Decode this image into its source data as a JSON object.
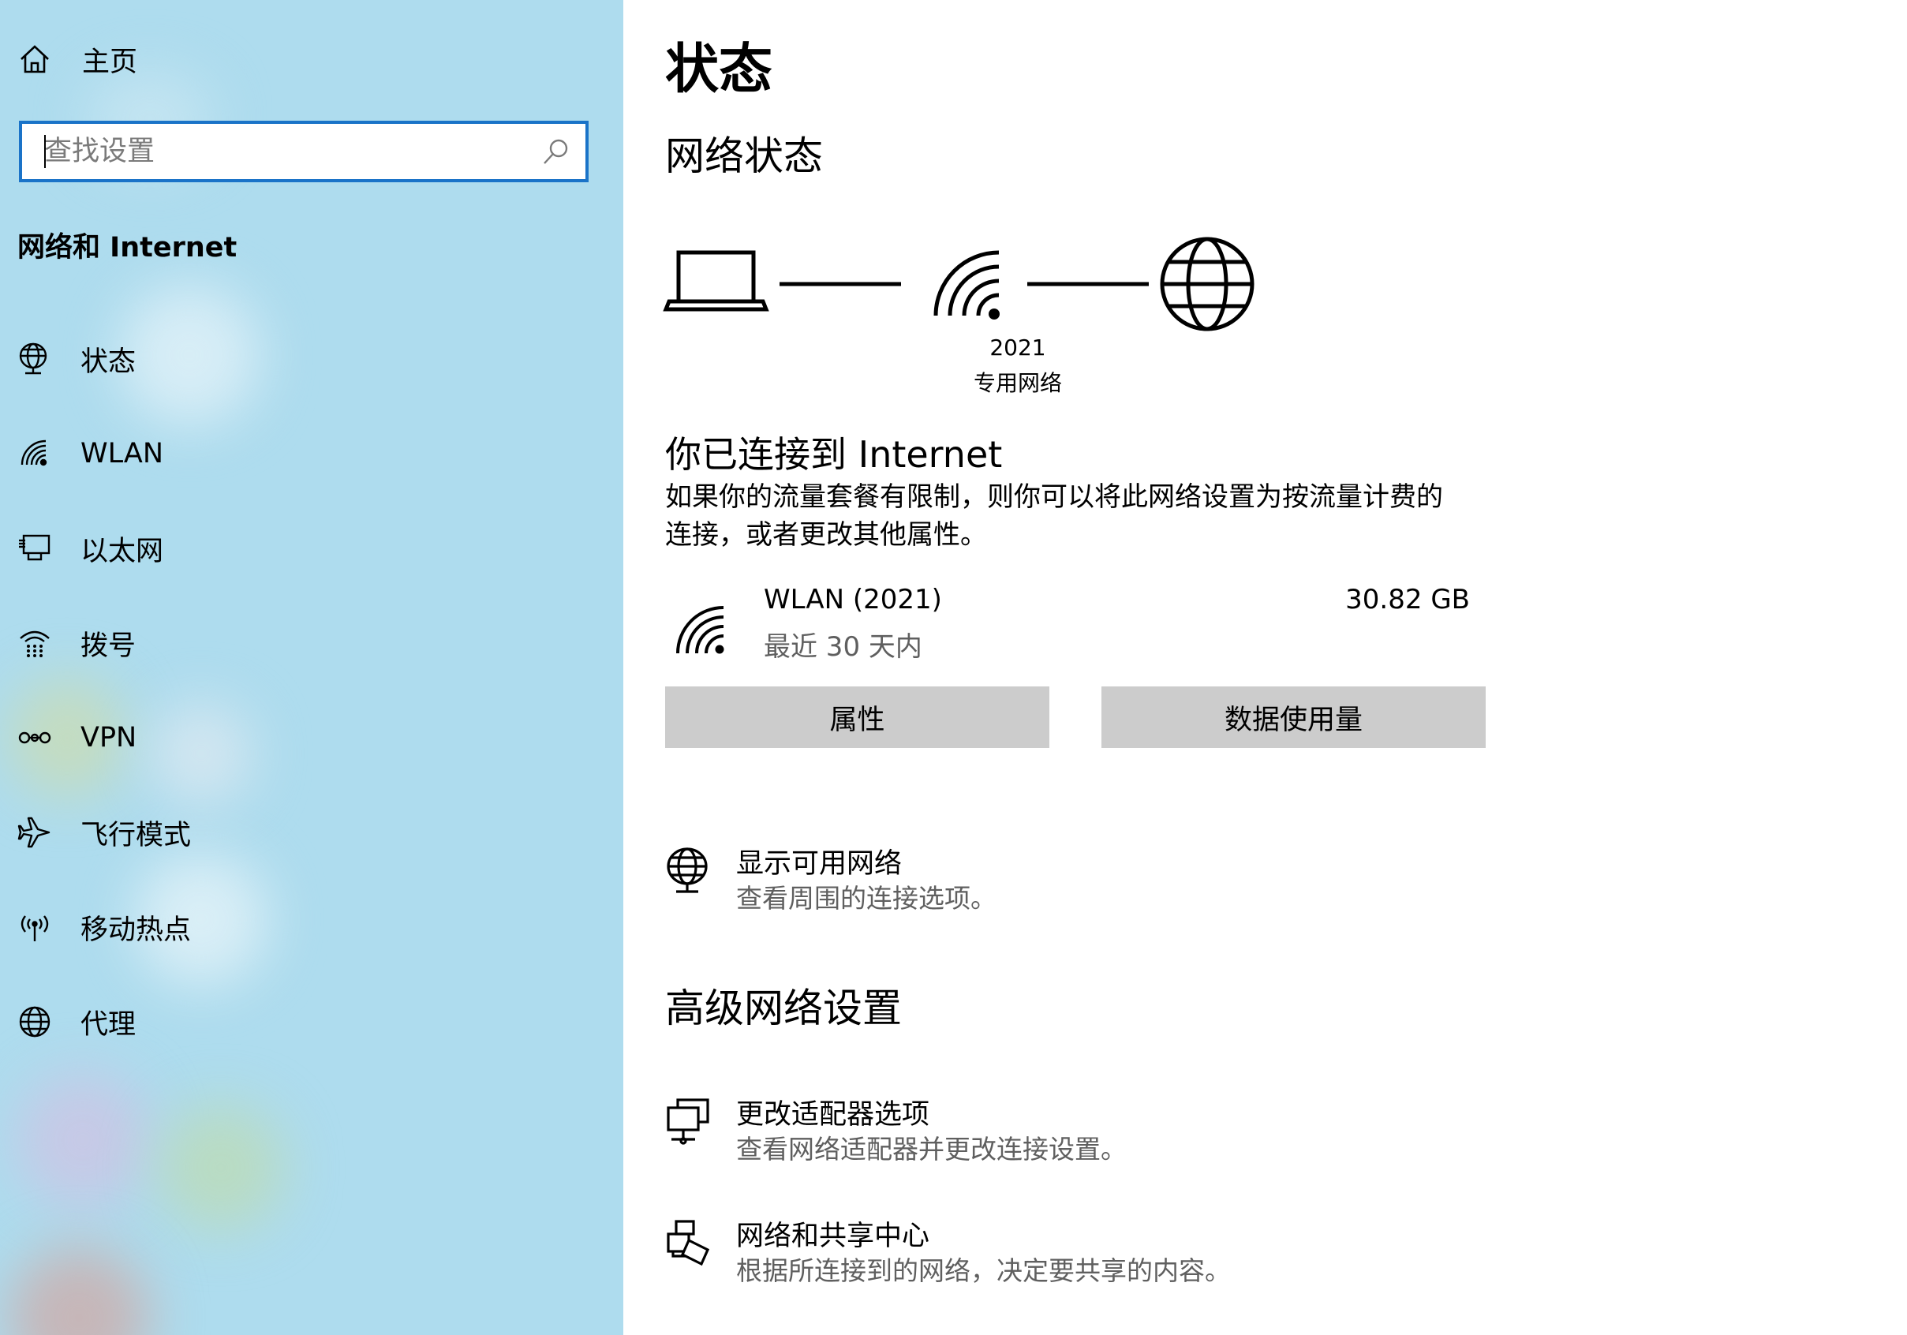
{
  "sidebar": {
    "home_label": "主页",
    "search_placeholder": "查找设置",
    "section_title": "网络和 Internet",
    "items": [
      {
        "label": "状态",
        "icon": "status-globe-icon"
      },
      {
        "label": "WLAN",
        "icon": "wifi-icon"
      },
      {
        "label": "以太网",
        "icon": "ethernet-icon"
      },
      {
        "label": "拨号",
        "icon": "dialup-icon"
      },
      {
        "label": "VPN",
        "icon": "vpn-icon"
      },
      {
        "label": "飞行模式",
        "icon": "airplane-icon"
      },
      {
        "label": "移动热点",
        "icon": "hotspot-icon"
      },
      {
        "label": "代理",
        "icon": "globe-icon"
      }
    ]
  },
  "main": {
    "title": "状态",
    "network_status_heading": "网络状态",
    "network": {
      "name": "2021",
      "type": "专用网络"
    },
    "connected_heading": "你已连接到 Internet",
    "description": "如果你的流量套餐有限制，则你可以将此网络设置为按流量计费的连接，或者更改其他属性。",
    "usage": {
      "name": "WLAN (2021)",
      "period": "最近 30 天内",
      "amount": "30.82 GB"
    },
    "buttons": {
      "properties": "属性",
      "data_usage": "数据使用量"
    },
    "show_networks": {
      "title": "显示可用网络",
      "subtitle": "查看周围的连接选项。"
    },
    "advanced_heading": "高级网络设置",
    "adapter_options": {
      "title": "更改适配器选项",
      "subtitle": "查看网络适配器并更改连接设置。"
    },
    "sharing_center": {
      "title": "网络和共享中心",
      "subtitle": "根据所连接到的网络，决定要共享的内容。"
    }
  },
  "colors": {
    "accent": "#1a73c8",
    "sidebar_bg": "#aedcee",
    "button_bg": "#cccccc",
    "secondary_text": "#5f5f5f"
  }
}
